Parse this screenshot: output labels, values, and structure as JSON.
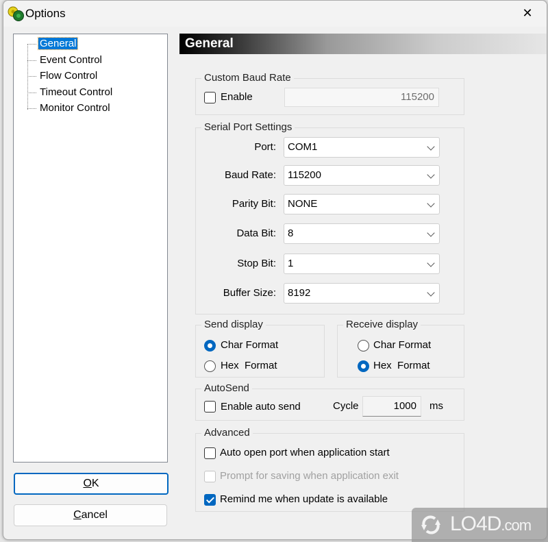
{
  "window": {
    "title": "Options",
    "app_icon": "gears-icon",
    "close_icon": "close-icon"
  },
  "sidebar": {
    "items": [
      {
        "label": "General",
        "selected": true
      },
      {
        "label": "Event Control",
        "selected": false
      },
      {
        "label": "Flow Control",
        "selected": false
      },
      {
        "label": "Timeout Control",
        "selected": false
      },
      {
        "label": "Monitor Control",
        "selected": false
      }
    ],
    "ok_label_mnemonic": "O",
    "ok_label_rest": "K",
    "cancel_label_mnemonic": "C",
    "cancel_label_rest": "ancel"
  },
  "panel": {
    "title": "General",
    "custom_baud": {
      "group_label": "Custom Baud Rate",
      "enable_label": "Enable",
      "enable_checked": false,
      "value": "115200"
    },
    "serial": {
      "group_label": "Serial Port Settings",
      "rows": [
        {
          "label": "Port:",
          "value": "COM1"
        },
        {
          "label": "Baud Rate:",
          "value": "115200"
        },
        {
          "label": "Parity Bit:",
          "value": "NONE"
        },
        {
          "label": "Data Bit:",
          "value": "8"
        },
        {
          "label": "Stop Bit:",
          "value": "1"
        },
        {
          "label": "Buffer Size:",
          "value": "8192"
        }
      ]
    },
    "send_display": {
      "group_label": "Send display",
      "options": [
        "Char Format",
        "Hex  Format"
      ],
      "selected": "Char Format"
    },
    "receive_display": {
      "group_label": "Receive display",
      "options": [
        "Char Format",
        "Hex  Format"
      ],
      "selected": "Hex  Format"
    },
    "autosend": {
      "group_label": "AutoSend",
      "enable_label": "Enable auto send",
      "enable_checked": false,
      "cycle_label": "Cycle",
      "cycle_value": "1000",
      "cycle_unit": "ms"
    },
    "advanced": {
      "group_label": "Advanced",
      "options": [
        {
          "label": "Auto open port when application start",
          "checked": false,
          "enabled": true
        },
        {
          "label": "Prompt for saving when application exit",
          "checked": false,
          "enabled": false
        },
        {
          "label": "Remind me when update is available",
          "checked": true,
          "enabled": true
        }
      ]
    }
  },
  "watermark": {
    "text": "LO4D",
    "suffix": ".com"
  }
}
